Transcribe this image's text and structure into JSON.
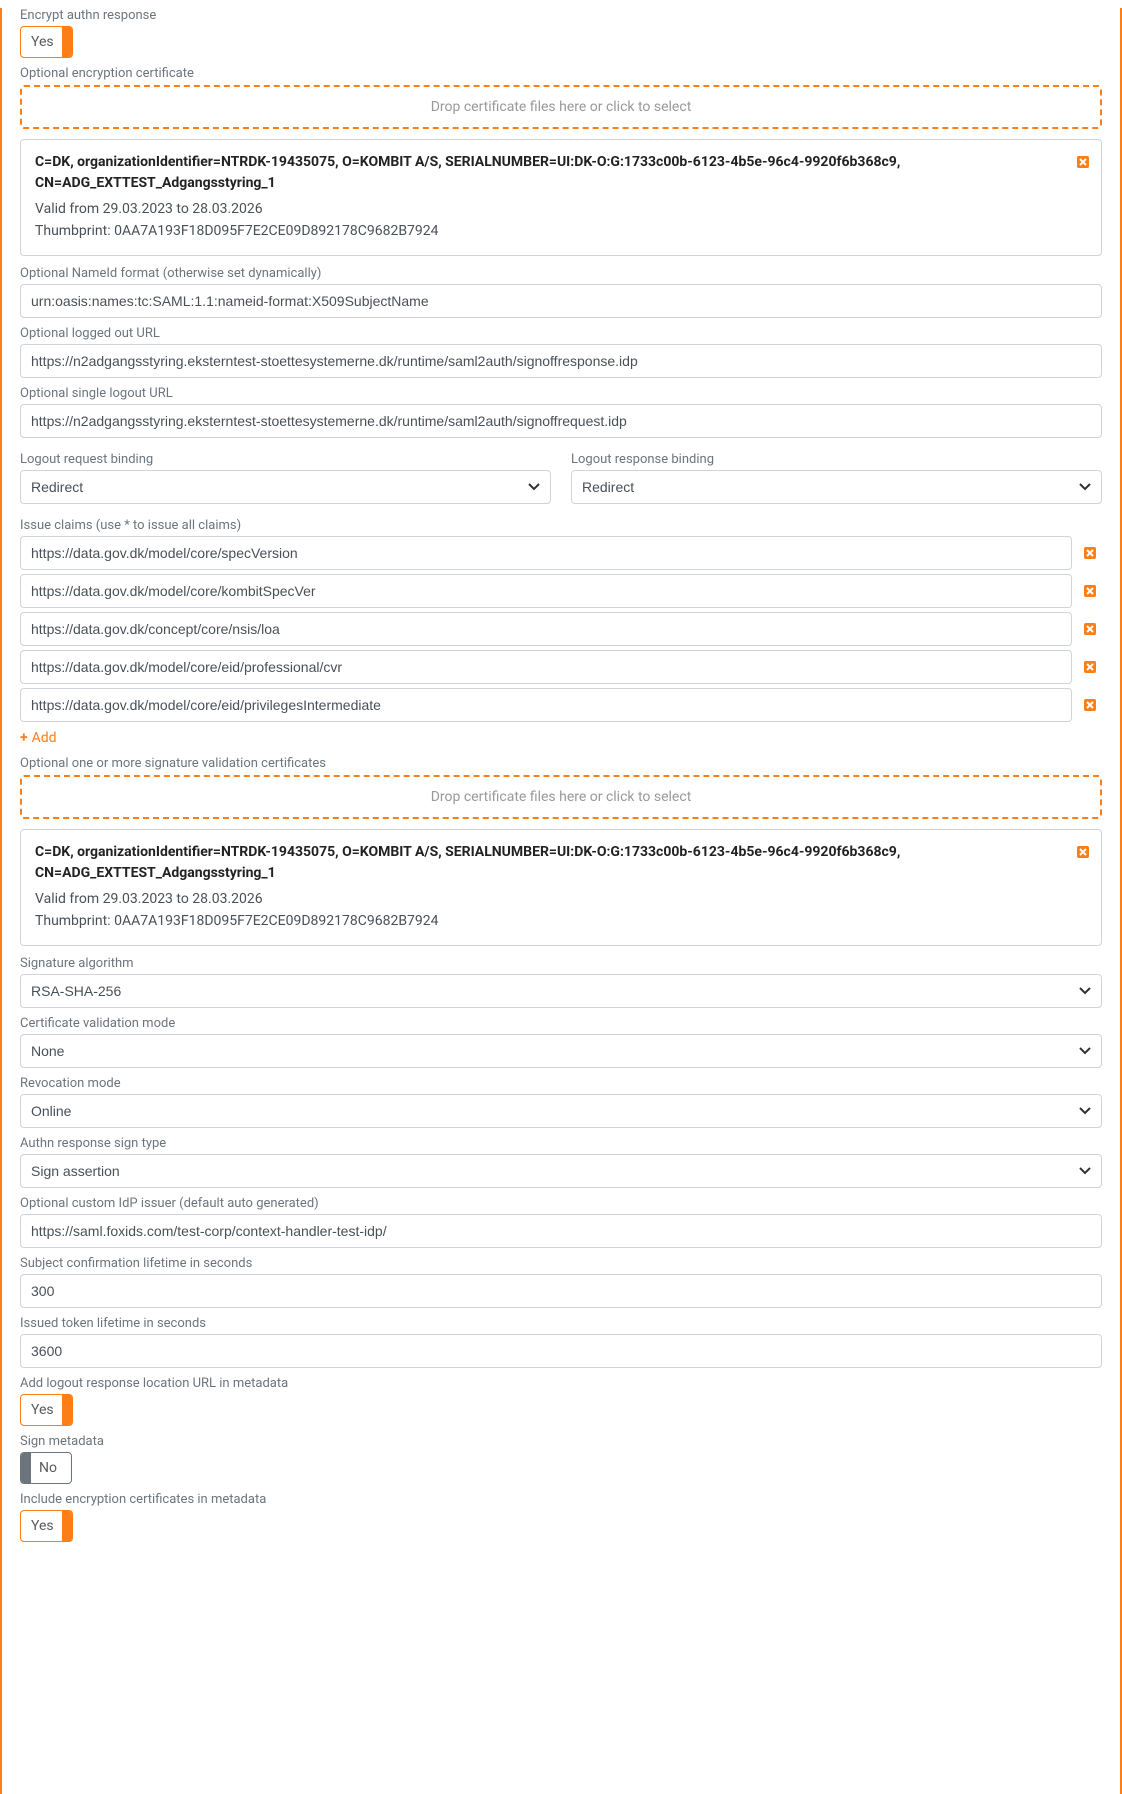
{
  "encrypt_authn": {
    "label": "Encrypt authn response",
    "value": "Yes"
  },
  "encryption_cert_label": "Optional encryption certificate",
  "dropzone_text": "Drop certificate files here or click to select",
  "cert1": {
    "subject": "C=DK, organizationIdentifier=NTRDK-19435075, O=KOMBIT A/S, SERIALNUMBER=UI:DK-O:G:1733c00b-6123-4b5e-96c4-9920f6b368c9, CN=ADG_EXTTEST_Adgangsstyring_1",
    "validity": "Valid from 29.03.2023 to 28.03.2026",
    "thumbprint": "Thumbprint: 0AA7A193F18D095F7E2CE09D892178C9682B7924"
  },
  "nameid": {
    "label": "Optional NameId format (otherwise set dynamically)",
    "value": "urn:oasis:names:tc:SAML:1.1:nameid-format:X509SubjectName"
  },
  "logged_out_url": {
    "label": "Optional logged out URL",
    "value": "https://n2adgangsstyring.eksterntest-stoettesystemerne.dk/runtime/saml2auth/signoffresponse.idp"
  },
  "single_logout_url": {
    "label": "Optional single logout URL",
    "value": "https://n2adgangsstyring.eksterntest-stoettesystemerne.dk/runtime/saml2auth/signoffrequest.idp"
  },
  "logout_request_binding": {
    "label": "Logout request binding",
    "value": "Redirect"
  },
  "logout_response_binding": {
    "label": "Logout response binding",
    "value": "Redirect"
  },
  "claims_label": "Issue claims (use * to issue all claims)",
  "claims": [
    "https://data.gov.dk/model/core/specVersion",
    "https://data.gov.dk/model/core/kombitSpecVer",
    "https://data.gov.dk/concept/core/nsis/loa",
    "https://data.gov.dk/model/core/eid/professional/cvr",
    "https://data.gov.dk/model/core/eid/privilegesIntermediate"
  ],
  "add_label": "Add",
  "sig_certs_label": "Optional one or more signature validation certificates",
  "cert2": {
    "subject": "C=DK, organizationIdentifier=NTRDK-19435075, O=KOMBIT A/S, SERIALNUMBER=UI:DK-O:G:1733c00b-6123-4b5e-96c4-9920f6b368c9, CN=ADG_EXTTEST_Adgangsstyring_1",
    "validity": "Valid from 29.03.2023 to 28.03.2026",
    "thumbprint": "Thumbprint: 0AA7A193F18D095F7E2CE09D892178C9682B7924"
  },
  "sig_algo": {
    "label": "Signature algorithm",
    "value": "RSA-SHA-256"
  },
  "cert_validation": {
    "label": "Certificate validation mode",
    "value": "None"
  },
  "revocation": {
    "label": "Revocation mode",
    "value": "Online"
  },
  "authn_sign_type": {
    "label": "Authn response sign type",
    "value": "Sign assertion"
  },
  "custom_issuer": {
    "label": "Optional custom IdP issuer (default auto generated)",
    "value": "https://saml.foxids.com/test-corp/context-handler-test-idp/"
  },
  "subject_lifetime": {
    "label": "Subject confirmation lifetime in seconds",
    "value": "300"
  },
  "token_lifetime": {
    "label": "Issued token lifetime in seconds",
    "value": "3600"
  },
  "add_logout_meta": {
    "label": "Add logout response location URL in metadata",
    "value": "Yes"
  },
  "sign_metadata": {
    "label": "Sign metadata",
    "value": "No"
  },
  "include_enc_meta": {
    "label": "Include encryption certificates in metadata",
    "value": "Yes"
  }
}
